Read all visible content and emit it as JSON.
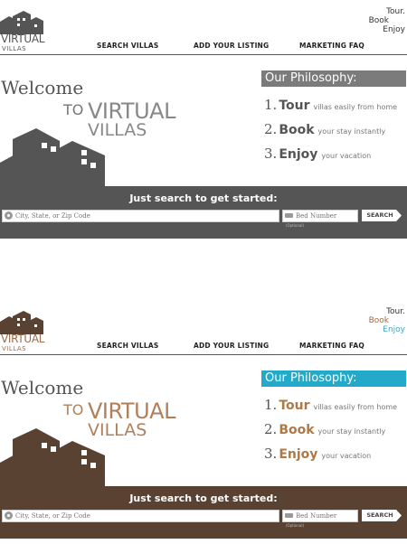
{
  "colors": {
    "gray_dark": "#555555",
    "gray_header": "#7b7b7b",
    "brown_dark": "#5a4233",
    "brown_accent": "#b07844",
    "teal": "#23a9c9"
  },
  "mockups": [
    {
      "logo": {
        "title": "VIRTUAL",
        "subtitle": "VILLAS"
      },
      "tagline": {
        "tour": "Tour.",
        "book": "Book",
        "enjoy": "Enjoy"
      },
      "nav": [
        "SEARCH VILLAS",
        "ADD YOUR LISTING",
        "MARKETING FAQ"
      ],
      "welcome": {
        "welcome": "Welcome",
        "to": "TO",
        "virtual": "VIRTUAL",
        "villas": "VILLAS"
      },
      "philosophy": {
        "heading": "Our Philosophy:",
        "items": [
          {
            "num": "1.",
            "word": "Tour",
            "desc": "villas easily from home"
          },
          {
            "num": "2.",
            "word": "Book",
            "desc": "your stay instantly"
          },
          {
            "num": "3.",
            "word": "Enjoy",
            "desc": "your vacation"
          }
        ]
      },
      "search": {
        "title": "Just search to get started:",
        "location_placeholder": "City, State, or Zip Code",
        "bed_placeholder": "Bed Number",
        "bed_note": "(Optional)",
        "button": "SEARCH"
      }
    },
    {
      "logo": {
        "title": "VIRTUAL",
        "subtitle": "VILLAS"
      },
      "tagline": {
        "tour": "Tour.",
        "book": "Book",
        "enjoy": "Enjoy"
      },
      "nav": [
        "SEARCH VILLAS",
        "ADD YOUR LISTING",
        "MARKETING FAQ"
      ],
      "welcome": {
        "welcome": "Welcome",
        "to": "TO",
        "virtual": "VIRTUAL",
        "villas": "VILLAS"
      },
      "philosophy": {
        "heading": "Our Philosophy:",
        "items": [
          {
            "num": "1.",
            "word": "Tour",
            "desc": "villas easily from home"
          },
          {
            "num": "2.",
            "word": "Book",
            "desc": "your stay instantly"
          },
          {
            "num": "3.",
            "word": "Enjoy",
            "desc": "your vacation"
          }
        ]
      },
      "search": {
        "title": "Just search to get started:",
        "location_placeholder": "City, State, or Zip Code",
        "bed_placeholder": "Bed Number",
        "bed_note": "(Optional)",
        "button": "SEARCH"
      }
    }
  ]
}
